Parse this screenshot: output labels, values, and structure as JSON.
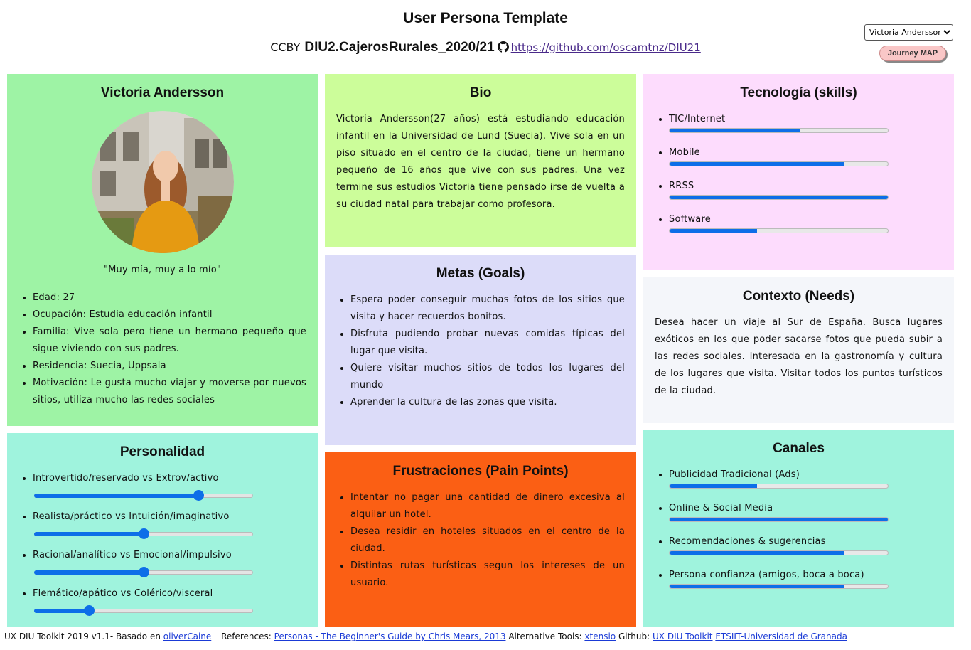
{
  "header": {
    "title": "User Persona Template",
    "license": "CCBY",
    "project": "DIU2.CajerosRurales_2020/21",
    "repo_url": "https://github.com/oscamtnz/DIU21"
  },
  "controls": {
    "persona_selected": "Victoria Andersson",
    "journey_button": "Journey MAP"
  },
  "profile": {
    "name": "Victoria Andersson",
    "quote": "\"Muy mía, muy a lo mío\"",
    "facts": [
      "Edad: 27",
      "Ocupación: Estudia educación infantil",
      "Familia: Vive sola pero tiene un hermano pequeño que sigue viviendo con sus padres.",
      "Residencia: Suecia, Uppsala",
      "Motivación: Le gusta mucho viajar y moverse por nuevos sitios, utiliza mucho las redes sociales"
    ]
  },
  "bio": {
    "title": "Bio",
    "text": "Victoria Andersson(27 años) está estudiando educación infantil en la Universidad de Lund (Suecia). Vive sola en un piso situado en el centro de la ciudad, tiene un hermano pequeño de 16 años que vive con sus padres. Una vez termine sus estudios Victoria tiene pensado irse de vuelta a su ciudad natal para trabajar como profesora."
  },
  "tech": {
    "title": "Tecnología (skills)",
    "items": [
      {
        "label": "TIC/Internet",
        "level": 0.6
      },
      {
        "label": "Mobile",
        "level": 0.8
      },
      {
        "label": "RRSS",
        "level": 1.0
      },
      {
        "label": "Software",
        "level": 0.4
      }
    ]
  },
  "goals": {
    "title": "Metas (Goals)",
    "items": [
      "Espera poder conseguir muchas fotos de los sitios que visita y hacer recuerdos bonitos.",
      "Disfruta pudiendo probar nuevas comidas típicas del lugar que visita.",
      "Quiere visitar muchos sitios de todos los lugares del mundo",
      "Aprender la cultura de las zonas que visita."
    ]
  },
  "context": {
    "title": "Contexto (Needs)",
    "text": "Desea hacer un viaje al Sur de España. Busca lugares exóticos en los que poder sacarse fotos que pueda subir a las redes sociales. Interesada en la gastronomía y cultura de los lugares que visita. Visitar todos los puntos turísticos de la ciudad."
  },
  "personality": {
    "title": "Personalidad",
    "items": [
      {
        "label": "Introvertido/reservado vs Extrov/activo",
        "value": 0.75
      },
      {
        "label": "Realista/práctico vs Intuición/imaginativo",
        "value": 0.5
      },
      {
        "label": "Racional/analítico vs Emocional/impulsivo",
        "value": 0.5
      },
      {
        "label": "Flemático/apático vs Colérico/visceral",
        "value": 0.25
      }
    ]
  },
  "frustrations": {
    "title": "Frustraciones (Pain Points)",
    "items": [
      "Intentar no pagar una cantidad de dinero excesiva al alquilar un hotel.",
      "Desea residir en hoteles situados en el centro de la ciudad.",
      "Distintas rutas turísticas segun los intereses de un usuario."
    ]
  },
  "channels": {
    "title": "Canales",
    "items": [
      {
        "label": "Publicidad Tradicional (Ads)",
        "level": 0.4
      },
      {
        "label": "Online & Social Media",
        "level": 1.0
      },
      {
        "label": "Recomendaciones & sugerencias",
        "level": 0.8
      },
      {
        "label": "Persona confianza (amigos, boca a boca)",
        "level": 0.8
      }
    ]
  },
  "footer": {
    "toolkit": "UX DIU Toolkit 2019 v1.1- Basado en",
    "toolkit_link": "oliverCaine",
    "refs_label": "References:",
    "refs_link": "Personas - The Beginner's Guide by Chris Mears, 2013",
    "alt_label": "Alternative Tools:",
    "alt_link": "xtensio",
    "github_label": "Github:",
    "github_link": "UX DIU Toolkit",
    "univ_link": "ETSIIT-Universidad de Granada"
  },
  "colors": {
    "profile": "#9ef3a5",
    "bio": "#ccfd9a",
    "tech": "#fddcfd",
    "goals": "#dcdcf9",
    "context": "#f4f6fa",
    "personality": "#9ff3dd",
    "frustrations": "#fb5f14",
    "channels": "#9ff3dd",
    "accent": "#0d6ee8"
  }
}
